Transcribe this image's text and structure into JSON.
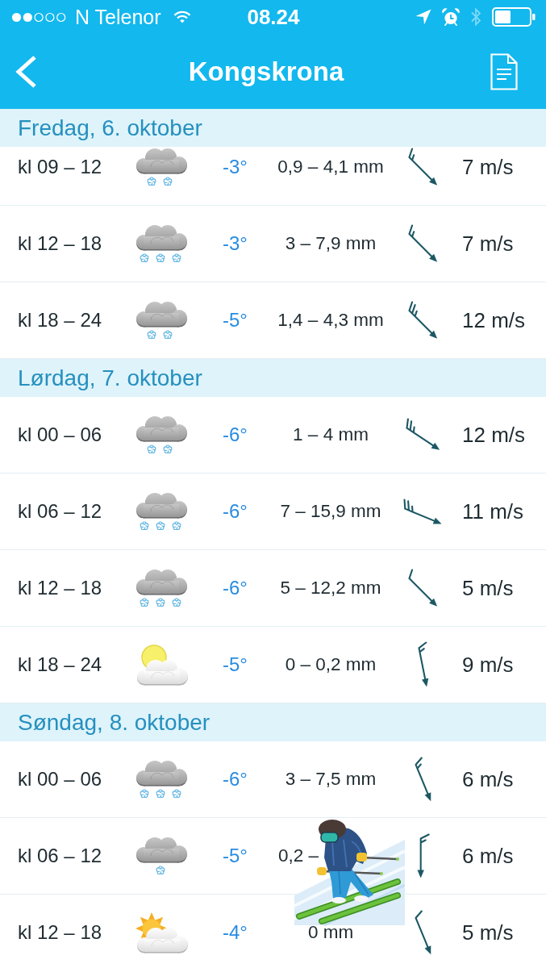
{
  "status_bar": {
    "carrier": "N Telenor",
    "time": "08.24"
  },
  "header": {
    "title": "Kongskrona"
  },
  "days": [
    {
      "label": "Fredag, 6. oktober",
      "rows": [
        {
          "time": "kl 09 – 12",
          "weather": {
            "kind": "snow"
          },
          "temperature": "-3°",
          "precipitation": "0,9 – 4,1 mm",
          "precipitation_covered": false,
          "wind": {
            "kind": "nw-full-half",
            "speed": "7 m/s"
          }
        },
        {
          "time": "kl 12 – 18",
          "weather": {
            "kind": "heavy-snow"
          },
          "temperature": "-3°",
          "precipitation": "3 – 7,9 mm",
          "precipitation_covered": false,
          "wind": {
            "kind": "nw-full-half",
            "speed": "7 m/s"
          }
        },
        {
          "time": "kl 18 – 24",
          "weather": {
            "kind": "snow"
          },
          "temperature": "-5°",
          "precipitation": "1,4 – 4,3 mm",
          "precipitation_covered": false,
          "wind": {
            "kind": "nw-full-full-half",
            "speed": "12 m/s"
          }
        }
      ]
    },
    {
      "label": "Lørdag, 7. oktober",
      "rows": [
        {
          "time": "kl 00 – 06",
          "weather": {
            "kind": "snow"
          },
          "temperature": "-6°",
          "precipitation": "1 – 4 mm",
          "precipitation_covered": false,
          "wind": {
            "kind": "nwbw-full-full-half",
            "speed": "12 m/s"
          }
        },
        {
          "time": "kl 06 – 12",
          "weather": {
            "kind": "heavy-snow"
          },
          "temperature": "-6°",
          "precipitation": "7 – 15,9 mm",
          "precipitation_covered": false,
          "wind": {
            "kind": "wnw-full-full-half",
            "speed": "11 m/s"
          }
        },
        {
          "time": "kl 12 – 18",
          "weather": {
            "kind": "heavy-snow"
          },
          "temperature": "-6°",
          "precipitation": "5 – 12,2 mm",
          "precipitation_covered": false,
          "wind": {
            "kind": "nw-full",
            "speed": "5 m/s"
          }
        },
        {
          "time": "kl 18 – 24",
          "weather": {
            "kind": "partly-cloudy-dim"
          },
          "temperature": "-5°",
          "precipitation": "0 – 0,2 mm",
          "precipitation_covered": false,
          "wind": {
            "kind": "nbw-full-half",
            "speed": "9 m/s"
          }
        }
      ]
    },
    {
      "label": "Søndag, 8. oktober",
      "rows": [
        {
          "time": "kl 00 – 06",
          "weather": {
            "kind": "heavy-snow"
          },
          "temperature": "-6°",
          "precipitation": "3 – 7,5 mm",
          "precipitation_covered": false,
          "wind": {
            "kind": "nnw-full-half",
            "speed": "6 m/s"
          }
        },
        {
          "time": "kl 06 – 12",
          "weather": {
            "kind": "light-snow"
          },
          "temperature": "-5°",
          "precipitation": "0,2 –",
          "precipitation_covered": true,
          "wind": {
            "kind": "n-full-half",
            "speed": "6 m/s"
          }
        },
        {
          "time": "kl 12 – 18",
          "weather": {
            "kind": "partly-cloudy"
          },
          "temperature": "-4°",
          "precipitation": "0 mm",
          "precipitation_covered": false,
          "wind": {
            "kind": "nnw-full",
            "speed": "5 m/s"
          }
        }
      ]
    }
  ]
}
